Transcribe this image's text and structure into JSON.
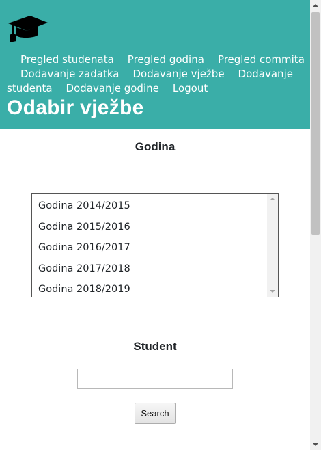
{
  "nav": {
    "items": [
      "Pregled studenata",
      "Pregled godina",
      "Pregled commita",
      "Dodavanje zadatka",
      "Dodavanje vježbe",
      "Dodavanje studenta",
      "Dodavanje godine",
      "Logout"
    ]
  },
  "page_title": "Odabir vježbe",
  "year_section": {
    "label": "Godina",
    "options": [
      "Godina 2014/2015",
      "Godina 2015/2016",
      "Godina 2016/2017",
      "Godina 2017/2018",
      "Godina 2018/2019"
    ]
  },
  "student_section": {
    "label": "Student",
    "input_value": "",
    "search_label": "Search"
  },
  "icons": {
    "logo": "graduation-cap-icon"
  },
  "colors": {
    "header_bg": "#3aaea8",
    "header_text": "#ffffff"
  }
}
